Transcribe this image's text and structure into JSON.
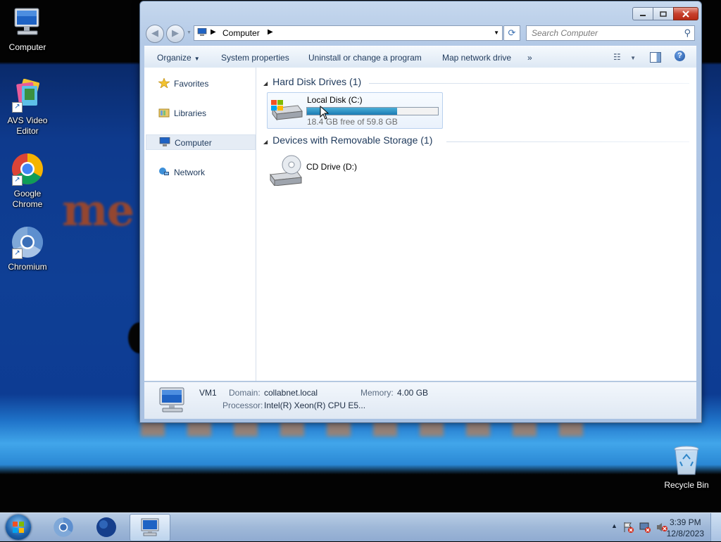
{
  "desktop": {
    "icons": [
      {
        "label": "Computer"
      },
      {
        "label": "AVS Video Editor"
      },
      {
        "label": "Google Chrome"
      },
      {
        "label": "Chromium"
      },
      {
        "label": "Recycle Bin"
      }
    ]
  },
  "window": {
    "address": {
      "path": "Computer"
    },
    "search": {
      "placeholder": "Search Computer"
    },
    "toolbar": {
      "organize": "Organize",
      "system_properties": "System properties",
      "uninstall": "Uninstall or change a program",
      "map_drive": "Map network drive",
      "more": "»",
      "help": "?"
    },
    "nav": [
      {
        "label": "Favorites",
        "icon": "star-icon"
      },
      {
        "label": "Libraries",
        "icon": "libraries-icon"
      },
      {
        "label": "Computer",
        "icon": "computer-icon",
        "selected": true
      },
      {
        "label": "Network",
        "icon": "network-icon"
      }
    ],
    "groups": {
      "hard_disk": {
        "title": "Hard Disk Drives (1)",
        "drives": [
          {
            "name": "Local Disk (C:)",
            "free_text": "18.4 GB free of 59.8 GB",
            "used_fraction": 0.69
          }
        ]
      },
      "removable": {
        "title": "Devices with Removable Storage (1)",
        "drives": [
          {
            "name": "CD Drive (D:)"
          }
        ]
      }
    },
    "details": {
      "computer_name": "VM1",
      "domain_label": "Domain:",
      "domain_value": "collabnet.local",
      "memory_label": "Memory:",
      "memory_value": "4.00 GB",
      "processor_label": "Processor:",
      "processor_value": "Intel(R) Xeon(R) CPU E5..."
    }
  },
  "taskbar": {
    "time": "3:39 PM",
    "date": "12/8/2023"
  },
  "colors": {
    "accent": "#1e395b",
    "progress": "#1b7bb4"
  }
}
